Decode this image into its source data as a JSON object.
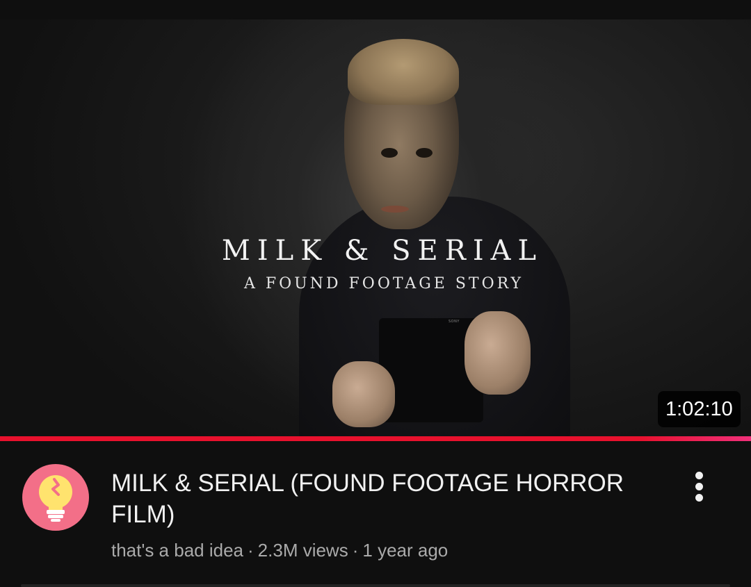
{
  "video": {
    "thumbnail_title": "MILK & SERIAL",
    "thumbnail_subtitle": "A FOUND FOOTAGE STORY",
    "thumbnail_brand": "SONY",
    "duration": "1:02:10",
    "watch_progress_percent": 100,
    "title": "MILK & SERIAL (FOUND FOOTAGE HORROR FILM)",
    "channel": "that's a bad idea",
    "views": "2.3M views",
    "age": "1 year ago",
    "separator": "·"
  },
  "avatar": {
    "icon": "lightbulb-icon",
    "background_color": "#f36f88",
    "bulb_color": "#ffe36e"
  },
  "actions": {
    "more_icon": "more-vert-icon"
  },
  "colors": {
    "background": "#0f0f0f",
    "progress": "#e8112d",
    "title_text": "#f1f1f1",
    "meta_text": "#aaaaaa"
  }
}
